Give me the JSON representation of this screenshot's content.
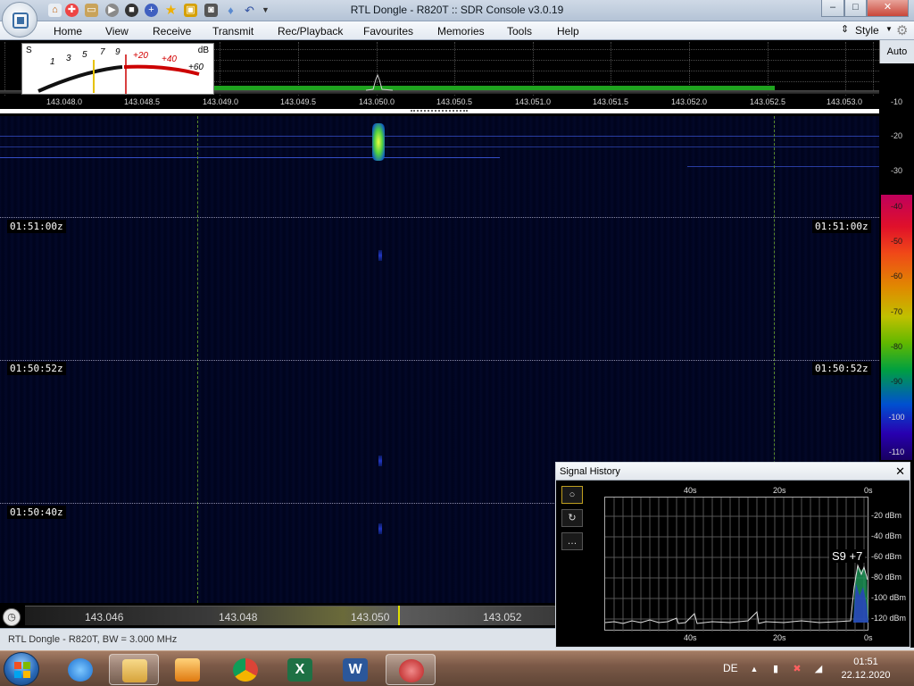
{
  "window": {
    "title": "RTL Dongle - R820T :: SDR Console v3.0.19",
    "minimize_glyph": "–",
    "maximize_glyph": "□",
    "close_glyph": "✕"
  },
  "menu": {
    "items": [
      "Home",
      "View",
      "Receive",
      "Transmit",
      "Rec/Playback",
      "Favourites",
      "Memories",
      "Tools",
      "Help"
    ],
    "style_label": "Style"
  },
  "smeter": {
    "s_label": "S",
    "db_label": "dB",
    "s_scale": [
      "1",
      "3",
      "5",
      "7",
      "9"
    ],
    "db_scale": [
      "+20",
      "+40",
      "+60"
    ]
  },
  "spectrum": {
    "freq_ticks": [
      "143.048.0",
      "143.048.5",
      "143.049.0",
      "143.049.5",
      "143.050.0",
      "143.050.5",
      "143.051.0",
      "143.051.5",
      "143.052.0",
      "143.052.5",
      "143.053.0"
    ]
  },
  "level_scale": {
    "auto_label": "Auto",
    "top_levels": [
      "-10",
      "-20",
      "-30"
    ],
    "colorbar_levels": [
      "-40",
      "-50",
      "-60",
      "-70",
      "-80",
      "-90",
      "-100",
      "-110"
    ],
    "colors": {
      "top": "#c0005c",
      "bottom": "#180060"
    }
  },
  "waterfall": {
    "time_labels": [
      "01:51:00z",
      "01:50:52z",
      "01:50:40z"
    ]
  },
  "tuning": {
    "freqs": [
      "143.046",
      "143.048",
      "143.050",
      "143.052"
    ],
    "marker_color": "#e0e000"
  },
  "status": {
    "text": "RTL Dongle - R820T, BW = 3.000 MHz"
  },
  "signal_history": {
    "title": "Signal History",
    "time_top": [
      "40s",
      "20s",
      "0s"
    ],
    "time_bottom": [
      "40s",
      "20s",
      "0s"
    ],
    "db_levels": [
      "-20 dBm",
      "-40 dBm",
      "-60 dBm",
      "-80 dBm",
      "-100 dBm",
      "-120 dBm"
    ],
    "reading": "S9 +7",
    "tools": [
      "circle-icon",
      "refresh-icon",
      "more-icon"
    ],
    "more_glyph": "…"
  },
  "taskbar": {
    "apps": [
      "start-button",
      "internet-explorer-icon",
      "file-explorer-icon",
      "media-player-icon",
      "chrome-icon",
      "excel-icon",
      "word-icon",
      "sdr-console-icon"
    ],
    "language": "DE",
    "time": "01:51",
    "date": "22.12.2020"
  }
}
